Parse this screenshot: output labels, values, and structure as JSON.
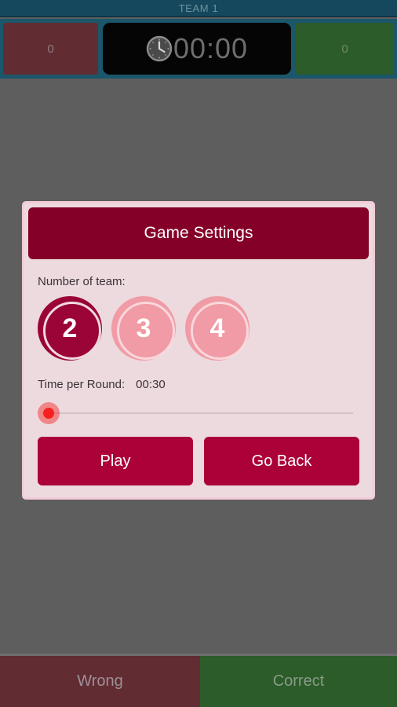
{
  "header": {
    "team_label": "TEAM 1"
  },
  "scoreboard": {
    "wrong_score": "0",
    "correct_score": "0",
    "timer_value": "00:00",
    "clock_icon": "clock-icon"
  },
  "dialog": {
    "title": "Game Settings",
    "number_of_team_label": "Number of team:",
    "team_options": [
      {
        "value": "2",
        "selected": true
      },
      {
        "value": "3",
        "selected": false
      },
      {
        "value": "4",
        "selected": false
      }
    ],
    "time_per_round_label": "Time per Round:",
    "time_per_round_value": "00:30",
    "slider": {
      "position_percent": 0,
      "min_label": "",
      "max_label": ""
    },
    "play_label": "Play",
    "go_back_label": "Go Back"
  },
  "bottom_bar": {
    "wrong_label": "Wrong",
    "correct_label": "Correct"
  },
  "colors": {
    "banner": "#15485c",
    "scoreboard": "#1b566b",
    "background": "#5e5e5e",
    "wrong": "#622c33",
    "correct": "#2b5c29",
    "dialog_header": "#850028",
    "dialog_body": "#ecdade",
    "dialog_border": "#f3ccd8",
    "button": "#ab0038",
    "selected_circle": "#9a0436",
    "unselected_circle": "#f09ba5",
    "slider_thumb": "#f72020"
  }
}
